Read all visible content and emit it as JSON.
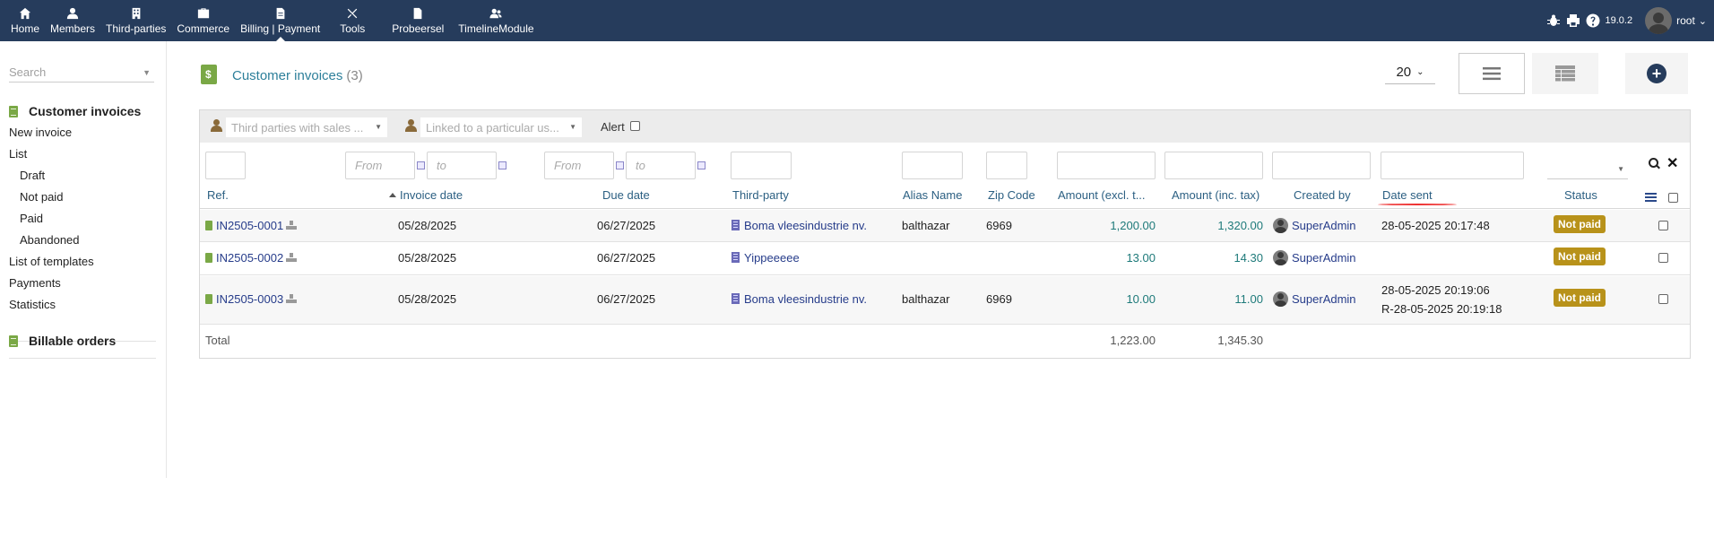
{
  "topnav": {
    "items": [
      {
        "label": "Home",
        "icon": "home-icon"
      },
      {
        "label": "Members",
        "icon": "user-icon"
      },
      {
        "label": "Third-parties",
        "icon": "building-icon"
      },
      {
        "label": "Commerce",
        "icon": "briefcase-icon"
      },
      {
        "label": "Billing | Payment",
        "icon": "file-invoice-icon"
      },
      {
        "label": "Tools",
        "icon": "tools-icon"
      },
      {
        "label": "Probeersel",
        "icon": "file-icon"
      },
      {
        "label": "TimelineModule",
        "icon": "users-icon"
      }
    ],
    "active": "Billing | Payment",
    "version": "19.0.2",
    "user": "root",
    "color": "#263c5c"
  },
  "leftmenu": {
    "search_placeholder": "Search",
    "section1_title": "Customer invoices",
    "new_invoice": "New invoice",
    "list": "List",
    "draft": "Draft",
    "not_paid": "Not paid",
    "paid": "Paid",
    "abandoned": "Abandoned",
    "list_templates": "List of templates",
    "payments": "Payments",
    "statistics": "Statistics",
    "section2_title": "Billable orders"
  },
  "header": {
    "title": "Customer invoices",
    "count": "(3)",
    "limit": "20"
  },
  "filters": {
    "thirdparty_placeholder": "Third parties with sales ...",
    "user_placeholder": "Linked to a particular us...",
    "alert_label": "Alert",
    "from": "From",
    "to": "to"
  },
  "columns": {
    "ref": "Ref.",
    "invoice_date": "Invoice date",
    "due_date": "Due date",
    "third_party": "Third-party",
    "alias": "Alias Name",
    "zip": "Zip Code",
    "amount_excl": "Amount (excl. t...",
    "amount_inc": "Amount (inc. tax)",
    "created_by": "Created by",
    "date_sent": "Date sent",
    "status": "Status"
  },
  "rows": [
    {
      "ref": "IN2505-0001",
      "invoice_date": "05/28/2025",
      "due_date": "06/27/2025",
      "third_party": "Boma vleesindustrie nv.",
      "alias": "balthazar",
      "zip": "6969",
      "amount_excl": "1,200.00",
      "amount_inc": "1,320.00",
      "created_by": "SuperAdmin",
      "date_sent": "28-05-2025 20:17:48",
      "date_sent2": "",
      "status": "Not paid"
    },
    {
      "ref": "IN2505-0002",
      "invoice_date": "05/28/2025",
      "due_date": "06/27/2025",
      "third_party": "Yippeeeee",
      "alias": "",
      "zip": "",
      "amount_excl": "13.00",
      "amount_inc": "14.30",
      "created_by": "SuperAdmin",
      "date_sent": "",
      "date_sent2": "",
      "status": "Not paid"
    },
    {
      "ref": "IN2505-0003",
      "invoice_date": "05/28/2025",
      "due_date": "06/27/2025",
      "third_party": "Boma vleesindustrie nv.",
      "alias": "balthazar",
      "zip": "6969",
      "amount_excl": "10.00",
      "amount_inc": "11.00",
      "created_by": "SuperAdmin",
      "date_sent": "28-05-2025 20:19:06",
      "date_sent2": "R-28-05-2025 20:19:18",
      "status": "Not paid"
    }
  ],
  "totals": {
    "label": "Total",
    "amount_excl": "1,223.00",
    "amount_inc": "1,345.30"
  }
}
